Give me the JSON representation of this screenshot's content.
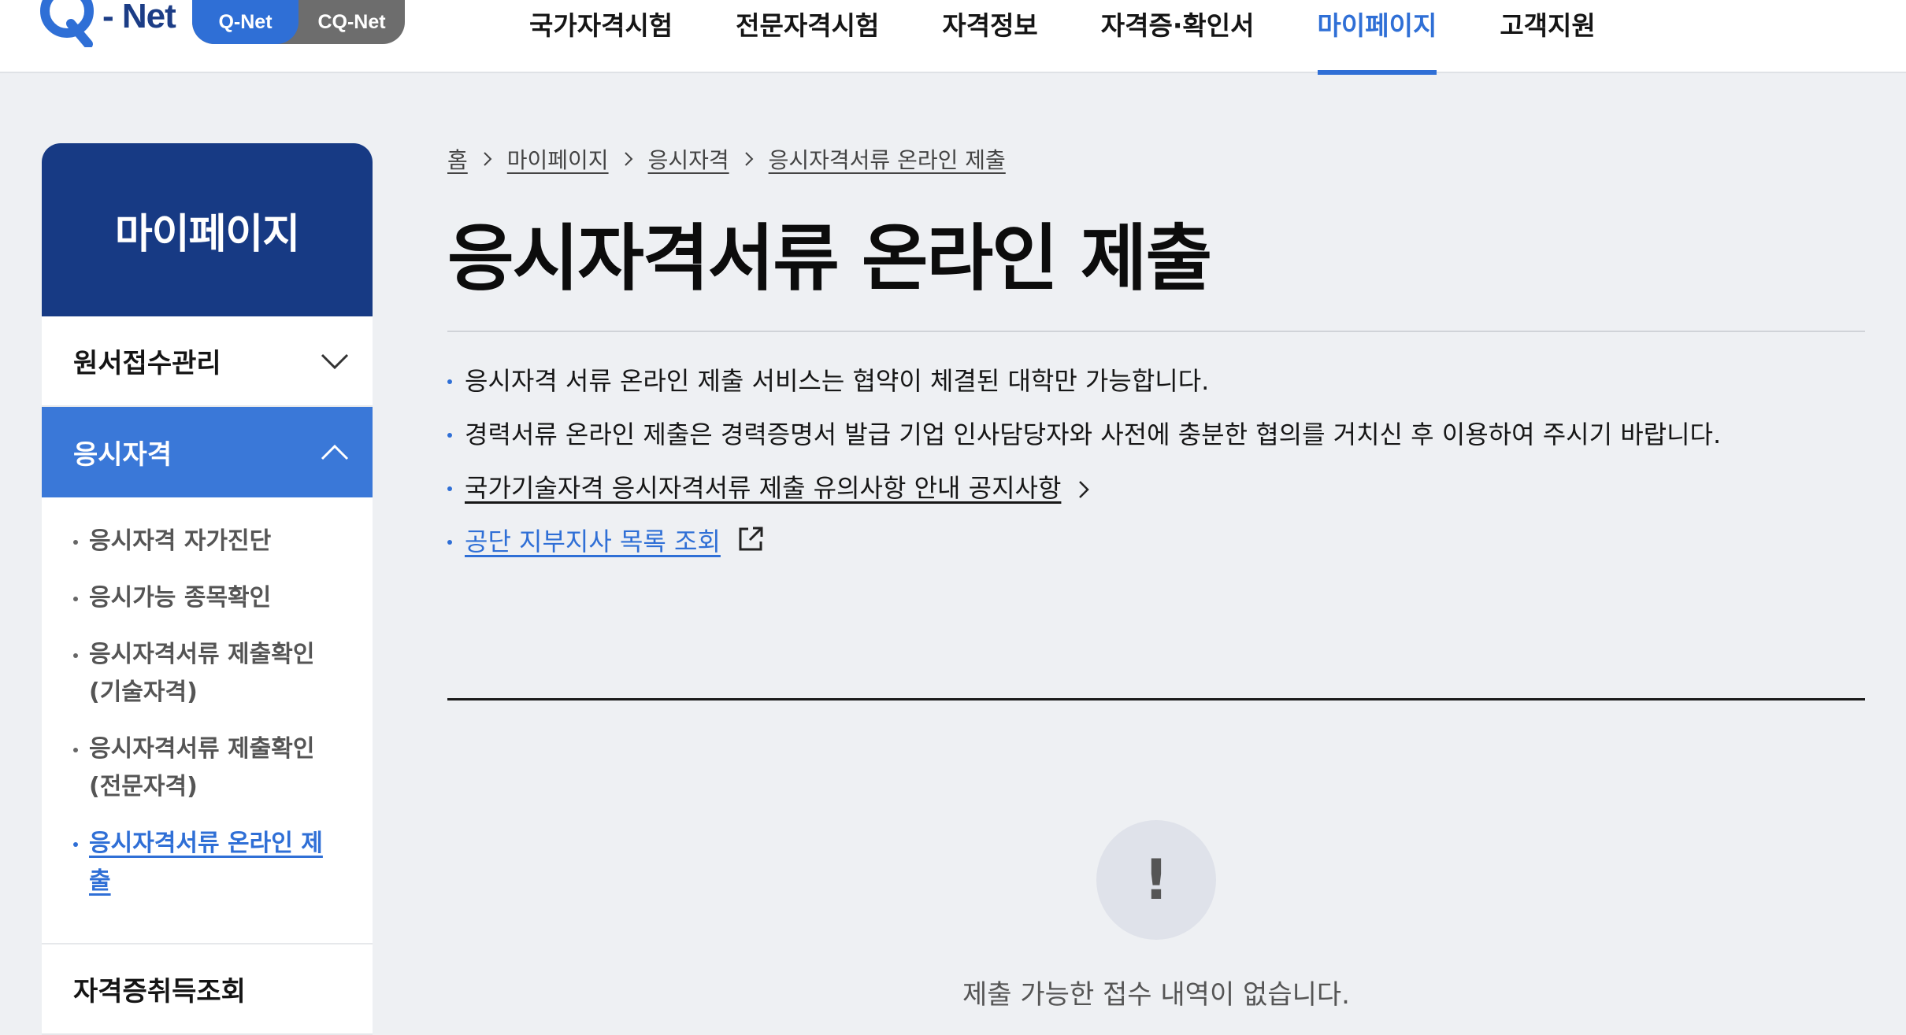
{
  "header": {
    "logo_text": "- Net",
    "toggle": [
      "Q-Net",
      "CQ-Net"
    ],
    "nav": [
      {
        "label": "국가자격시험"
      },
      {
        "label": "전문자격시험"
      },
      {
        "label": "자격정보"
      },
      {
        "label": "자격증·확인서"
      },
      {
        "label": "마이페이지",
        "active": true
      },
      {
        "label": "고객지원"
      }
    ]
  },
  "sidebar": {
    "title": "마이페이지",
    "menus": [
      {
        "label": "원서접수관리",
        "state": "collapsed",
        "icon": "chevron-down-icon"
      },
      {
        "label": "응시자격",
        "state": "expanded",
        "icon": "chevron-up-icon"
      }
    ],
    "submenu": [
      "응시자격 자가진단",
      "응시가능 종목확인",
      "응시자격서류 제출확인\n(기술자격)",
      "응시자격서류 제출확인\n(전문자격)",
      "응시자격서류 온라인 제출"
    ],
    "after_menu": "자격증취득조회"
  },
  "breadcrumb": [
    "홈",
    "마이페이지",
    "응시자격",
    "응시자격서류 온라인 제출"
  ],
  "page_title": "응시자격서류 온라인 제출",
  "notices": {
    "n1": "응시자격 서류 온라인 제출 서비스는 협약이 체결된 대학만 가능합니다.",
    "n2": "경력서류 온라인 제출은 경력증명서 발급 기업 인사담당자와 사전에 충분한 협의를 거치신 후 이용하여 주시기 바랍니다.",
    "n3": "국가기술자격 응시자격서류 제출 유의사항 안내 공지사항",
    "n4": "공단 지부지사 목록 조회"
  },
  "empty_state": {
    "icon": "!",
    "message": "제출 가능한 접수 내역이 없습니다."
  },
  "colors": {
    "brand_navy": "#173a84",
    "accent_blue": "#2f6fd6",
    "bg": "#eef0f3"
  }
}
